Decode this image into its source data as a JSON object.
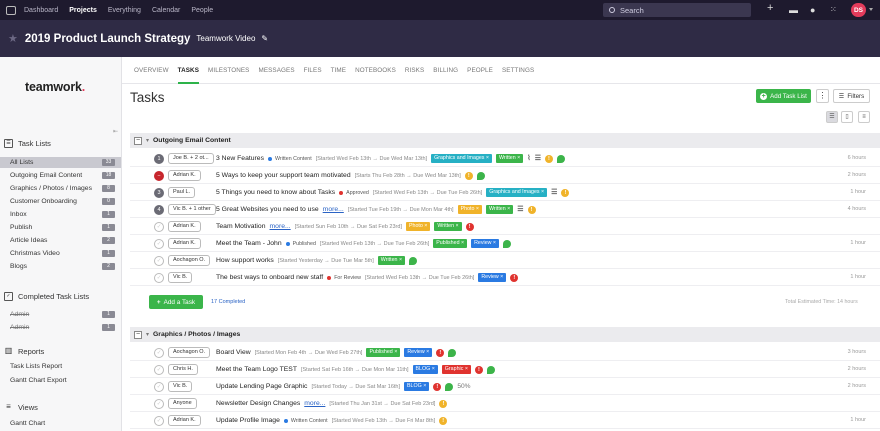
{
  "topnav": {
    "items": [
      "Dashboard",
      "Projects",
      "Everything",
      "Calendar",
      "People"
    ],
    "active_index": 1,
    "search_placeholder": "Search",
    "user_initials": "DS"
  },
  "project": {
    "title": "2019 Product Launch Strategy",
    "company": "Teamwork Video"
  },
  "sidebar": {
    "brand": "teamwork",
    "brand_dot": ".",
    "task_lists_heading": "Task Lists",
    "task_lists": [
      {
        "label": "All Lists",
        "count": "33",
        "selected": true
      },
      {
        "label": "Outgoing Email Content",
        "count": "18"
      },
      {
        "label": "Graphics / Photos / Images",
        "count": "8"
      },
      {
        "label": "Customer Onboarding",
        "count": "0"
      },
      {
        "label": "Inbox",
        "count": "1"
      },
      {
        "label": "Publish",
        "count": "1"
      },
      {
        "label": "Article Ideas",
        "count": "2"
      },
      {
        "label": "Christmas Video",
        "count": "1"
      },
      {
        "label": "Blogs",
        "count": "2"
      }
    ],
    "completed_heading": "Completed Task Lists",
    "completed_lists": [
      {
        "label": "Admin",
        "count": "1"
      },
      {
        "label": "Admin",
        "count": "1"
      }
    ],
    "reports_heading": "Reports",
    "reports": [
      "Task Lists Report",
      "Gantt Chart Export"
    ],
    "views_heading": "Views",
    "views": [
      "Gantt Chart"
    ]
  },
  "tabs": [
    "OVERVIEW",
    "TASKS",
    "MILESTONES",
    "MESSAGES",
    "FILES",
    "TIME",
    "NOTEBOOKS",
    "RISKS",
    "BILLING",
    "PEOPLE",
    "SETTINGS"
  ],
  "active_tab_index": 1,
  "page_title": "Tasks",
  "add_task_list_label": "Add Task List",
  "filters_label": "Filters",
  "groups": [
    {
      "name": "Outgoing Email Content",
      "tasks": [
        {
          "circle": "1",
          "circle_style": "num",
          "assignee": "Joe B. + 2 ot...",
          "name": "3 New Features",
          "status": "Written Content",
          "status_color": "#2a7ae2",
          "dates": "[Started Wed Feb 13th → Due Wed Mar 13th]",
          "tags": [
            {
              "text": "Graphics and Images ×",
              "color": "#26b0c4"
            },
            {
              "text": "Written ×",
              "color": "#3bb54a"
            }
          ],
          "icons": [
            "clip",
            "list",
            "y",
            "g"
          ],
          "estimate": "6 hours"
        },
        {
          "circle": "−",
          "circle_style": "red",
          "assignee": "Adrian K.",
          "name": "5 Ways to keep your support team motivated",
          "dates": "[Starts Thu Feb 28th → Due Wed Mar 13th]",
          "tags": [],
          "icons": [
            "y",
            "g"
          ],
          "estimate": "2 hours"
        },
        {
          "circle": "3",
          "circle_style": "num",
          "assignee": "Paul L.",
          "name": "5 Things you need to know about Tasks",
          "status": "Approved",
          "status_color": "#e0332f",
          "dates": "[Started Wed Feb 13th → Due Tue Feb 26th]",
          "tags": [
            {
              "text": "Graphics and Images ×",
              "color": "#26b0c4"
            }
          ],
          "icons": [
            "list",
            "y"
          ],
          "estimate": "1 hour"
        },
        {
          "circle": "4",
          "circle_style": "num",
          "assignee": "Vic B. + 1 other",
          "name": "5 Great Websites you need to use",
          "more": "more...",
          "dates": "[Started Tue Feb 19th → Due Mon Mar 4th]",
          "tags": [
            {
              "text": "Photo ×",
              "color": "#f0b32a"
            },
            {
              "text": "Written ×",
              "color": "#3bb54a"
            }
          ],
          "icons": [
            "list",
            "y"
          ],
          "estimate": "4 hours"
        },
        {
          "circle": "✓",
          "circle_style": "chk",
          "assignee": "Adrian K.",
          "name": "Team Motivation",
          "more": "more...",
          "dates": "[Started Sun Feb 10th → Due Sat Feb 23rd]",
          "tags": [
            {
              "text": "Photo ×",
              "color": "#f0b32a"
            },
            {
              "text": "Written ×",
              "color": "#3bb54a"
            }
          ],
          "icons": [
            "r"
          ],
          "estimate": ""
        },
        {
          "circle": "✓",
          "circle_style": "chk",
          "assignee": "Adrian K.",
          "name": "Meet the Team - John",
          "status": "Published",
          "status_color": "#2a7ae2",
          "dates": "[Started Wed Feb 13th → Due Tue Feb 26th]",
          "tags": [
            {
              "text": "Published ×",
              "color": "#3bb54a"
            },
            {
              "text": "Review ×",
              "color": "#2a7ae2"
            }
          ],
          "icons": [
            "g"
          ],
          "estimate": "1 hour"
        },
        {
          "circle": "✓",
          "circle_style": "chk",
          "assignee": "Aochagon O.",
          "name": "How support works",
          "dates": "[Started Yesterday → Due Tue Mar 5th]",
          "tags": [
            {
              "text": "Written ×",
              "color": "#3bb54a"
            }
          ],
          "icons": [
            "g"
          ],
          "estimate": ""
        },
        {
          "circle": "✓",
          "circle_style": "chk",
          "assignee": "Vic B.",
          "name": "The best ways to onboard new staff",
          "status": "For Review",
          "status_color": "#e0332f",
          "dates": "[Started Wed Feb 13th → Due Tue Feb 26th]",
          "tags": [
            {
              "text": "Review ×",
              "color": "#2a7ae2"
            }
          ],
          "icons": [
            "r"
          ],
          "estimate": "1 hour"
        }
      ],
      "add_task_label": "Add a Task",
      "completed_label": "17 Completed",
      "total_estimate": "Total Estimated Time: 14 hours"
    },
    {
      "name": "Graphics / Photos / Images",
      "tasks": [
        {
          "circle": "✓",
          "circle_style": "chk",
          "assignee": "Aochagon O.",
          "name": "Board View",
          "dates": "[Started Mon Feb 4th → Due Wed Feb 27th]",
          "tags": [
            {
              "text": "Published ×",
              "color": "#3bb54a"
            },
            {
              "text": "Review ×",
              "color": "#2a7ae2"
            }
          ],
          "icons": [
            "r",
            "g"
          ],
          "estimate": "3 hours"
        },
        {
          "circle": "✓",
          "circle_style": "chk",
          "assignee": "Chris H.",
          "name": "Meet the Team Logo TEST",
          "dates": "[Started Sat Feb 16th → Due Mon Mar 11th]",
          "tags": [
            {
              "text": "BLOG ×",
              "color": "#2a7ae2"
            },
            {
              "text": "Graphic ×",
              "color": "#e0332f"
            }
          ],
          "icons": [
            "r",
            "g"
          ],
          "estimate": "2 hours"
        },
        {
          "circle": "✓",
          "circle_style": "chk",
          "assignee": "Vic B.",
          "name": "Update Lending Page Graphic",
          "dates": "[Started Today → Due Sat Mar 16th]",
          "tags": [
            {
              "text": "BLOG ×",
              "color": "#2a7ae2"
            }
          ],
          "icons": [
            "r",
            "g"
          ],
          "progress": "50%",
          "estimate": "2 hours"
        },
        {
          "circle": "✓",
          "circle_style": "chk",
          "assignee": "Anyone",
          "name": "Newsletter Design Changes",
          "more": "more...",
          "dates": "[Started Thu Jan 31st → Due Sat Feb 23rd]",
          "tags": [],
          "icons": [
            "y"
          ],
          "estimate": ""
        },
        {
          "circle": "✓",
          "circle_style": "chk",
          "assignee": "Adrian K.",
          "name": "Update Profile Image",
          "status": "Written Content",
          "status_color": "#2a7ae2",
          "dates": "[Started Wed Feb 13th → Due Fri Mar 8th]",
          "tags": [],
          "icons": [
            "y"
          ],
          "estimate": "1 hour"
        }
      ]
    }
  ],
  "colors": {
    "accent": "#3bb54a",
    "topbar": "#1e1a2e",
    "projectbar": "#2f2b45",
    "brand_dot": "#e33b5b"
  }
}
